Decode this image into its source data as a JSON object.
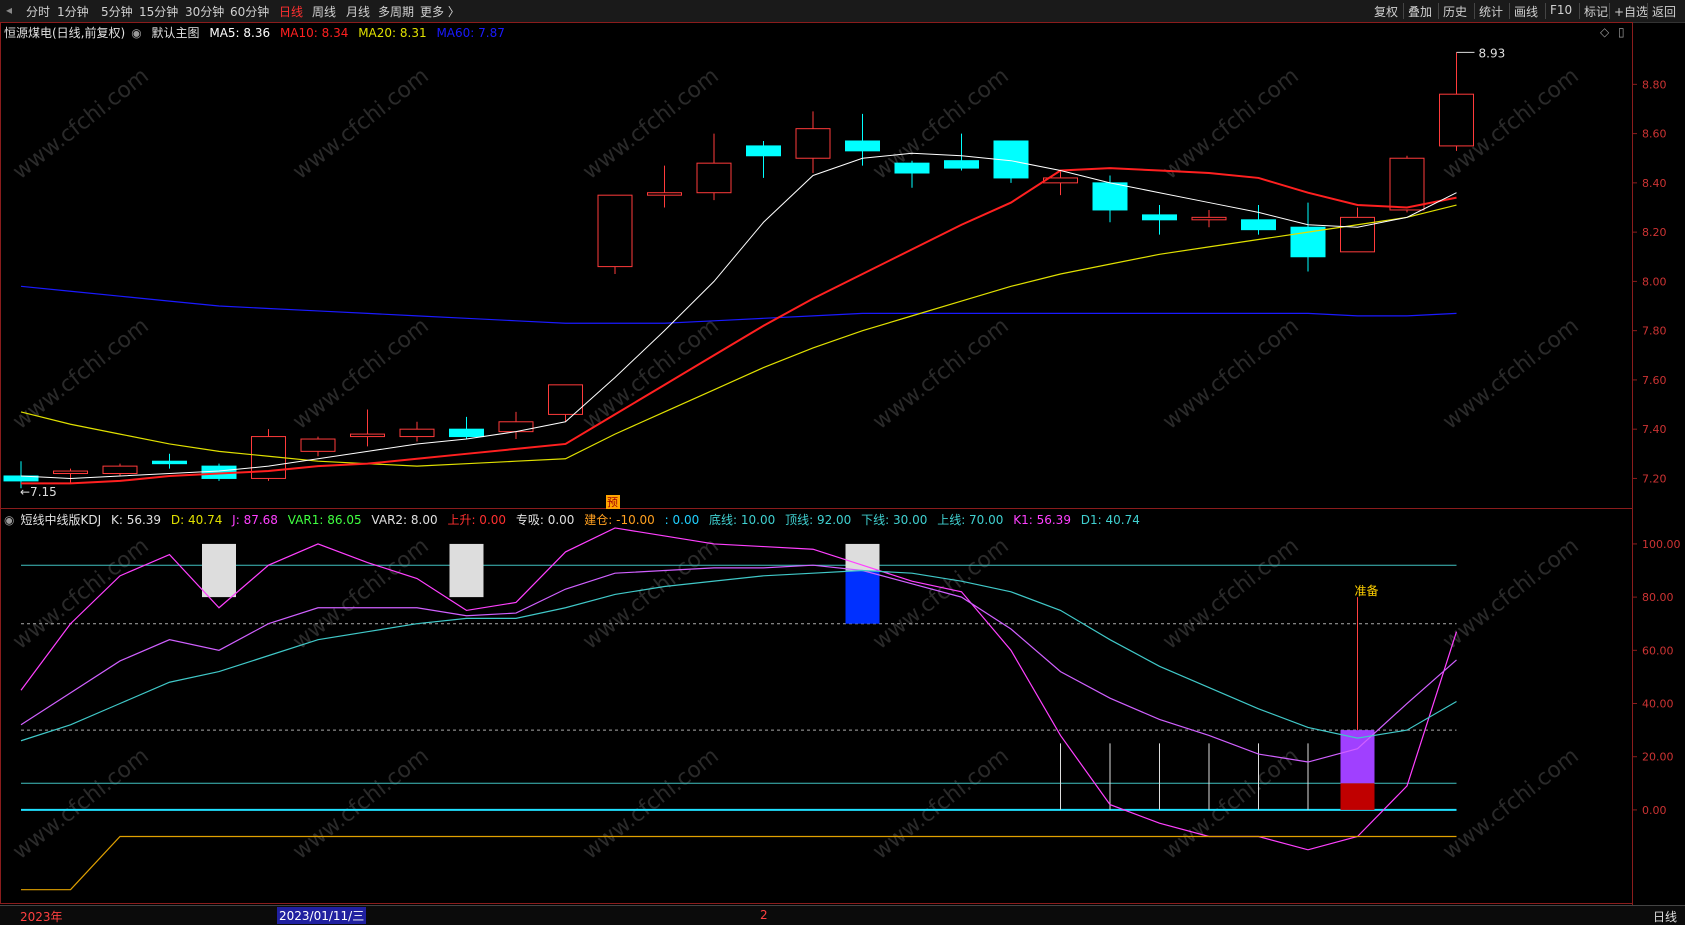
{
  "toolbar": {
    "left": [
      "分时",
      "1分钟",
      "5分钟",
      "15分钟",
      "30分钟",
      "60分钟",
      "日线",
      "周线",
      "月线",
      "多周期",
      "更多 〉"
    ],
    "active": "日线",
    "right": [
      "复权",
      "叠加",
      "历史",
      "统计",
      "画线",
      "F10",
      "标记",
      "+自选",
      "返回"
    ]
  },
  "main_legend": {
    "stock": "恒源煤电(日线,前复权)",
    "template": "默认主图",
    "ma5": "MA5: 8.36",
    "ma10": "MA10: 8.34",
    "ma20": "MA20: 8.31",
    "ma60": "MA60: 7.87"
  },
  "kdj_legend": {
    "name": "短线中线版KDJ",
    "k": "K: 56.39",
    "d": "D: 40.74",
    "j": "J: 87.68",
    "var1": "VAR1: 86.05",
    "var2": "VAR2: 8.00",
    "up": "上升: 0.00",
    "zx": "专吸: 0.00",
    "jc": "建仓: -10.00",
    "zero": ": 0.00",
    "bottom": "底线: 10.00",
    "top": "顶线: 92.00",
    "lower": "下线: 30.00",
    "upper": "上线: 70.00",
    "k1": "K1: 56.39",
    "d1": "D1: 40.74"
  },
  "annotations": {
    "high": "8.93",
    "low": "7.15",
    "pre": "预",
    "ready": "准备"
  },
  "bottom": {
    "year": "2023年",
    "date": "2023/01/11/三",
    "mark": "2",
    "daily_btn": "日线"
  },
  "watermark": "www.cfchi.com",
  "colors": {
    "up": "#ff3b3b",
    "down": "#00ffff",
    "ma5": "#ffffff",
    "ma10": "#ff2020",
    "ma20": "#e0e000",
    "ma60": "#1a1aff"
  },
  "chart_data": [
    {
      "type": "candlestick",
      "title": "恒源煤电(日线,前复权)",
      "y_ticks": [
        7.2,
        7.4,
        7.6,
        7.8,
        8.0,
        8.2,
        8.4,
        8.6,
        8.8
      ],
      "ylim": [
        7.08,
        8.98
      ],
      "candles": [
        {
          "o": 7.21,
          "c": 7.19,
          "h": 7.27,
          "l": 7.16
        },
        {
          "o": 7.22,
          "c": 7.23,
          "h": 7.24,
          "l": 7.18
        },
        {
          "o": 7.22,
          "c": 7.25,
          "h": 7.26,
          "l": 7.21
        },
        {
          "o": 7.27,
          "c": 7.26,
          "h": 7.3,
          "l": 7.24
        },
        {
          "o": 7.25,
          "c": 7.2,
          "h": 7.26,
          "l": 7.19
        },
        {
          "o": 7.2,
          "c": 7.37,
          "h": 7.4,
          "l": 7.19
        },
        {
          "o": 7.31,
          "c": 7.36,
          "h": 7.37,
          "l": 7.29
        },
        {
          "o": 7.37,
          "c": 7.38,
          "h": 7.48,
          "l": 7.33
        },
        {
          "o": 7.37,
          "c": 7.4,
          "h": 7.43,
          "l": 7.35
        },
        {
          "o": 7.4,
          "c": 7.37,
          "h": 7.45,
          "l": 7.36
        },
        {
          "o": 7.39,
          "c": 7.43,
          "h": 7.47,
          "l": 7.36
        },
        {
          "o": 7.46,
          "c": 7.58,
          "h": 7.58,
          "l": 7.43
        },
        {
          "o": 8.06,
          "c": 8.35,
          "h": 8.35,
          "l": 8.03
        },
        {
          "o": 8.35,
          "c": 8.36,
          "h": 8.47,
          "l": 8.3
        },
        {
          "o": 8.36,
          "c": 8.48,
          "h": 8.6,
          "l": 8.33
        },
        {
          "o": 8.55,
          "c": 8.51,
          "h": 8.57,
          "l": 8.42
        },
        {
          "o": 8.5,
          "c": 8.62,
          "h": 8.69,
          "l": 8.44
        },
        {
          "o": 8.57,
          "c": 8.53,
          "h": 8.68,
          "l": 8.47
        },
        {
          "o": 8.48,
          "c": 8.44,
          "h": 8.49,
          "l": 8.38
        },
        {
          "o": 8.49,
          "c": 8.46,
          "h": 8.6,
          "l": 8.45
        },
        {
          "o": 8.57,
          "c": 8.42,
          "h": 8.57,
          "l": 8.4
        },
        {
          "o": 8.4,
          "c": 8.42,
          "h": 8.45,
          "l": 8.35
        },
        {
          "o": 8.4,
          "c": 8.29,
          "h": 8.43,
          "l": 8.24
        },
        {
          "o": 8.27,
          "c": 8.25,
          "h": 8.31,
          "l": 8.19
        },
        {
          "o": 8.25,
          "c": 8.26,
          "h": 8.29,
          "l": 8.22
        },
        {
          "o": 8.25,
          "c": 8.21,
          "h": 8.31,
          "l": 8.19
        },
        {
          "o": 8.22,
          "c": 8.1,
          "h": 8.32,
          "l": 8.04
        },
        {
          "o": 8.12,
          "c": 8.26,
          "h": 8.3,
          "l": 8.12
        },
        {
          "o": 8.29,
          "c": 8.5,
          "h": 8.51,
          "l": 8.28
        },
        {
          "o": 8.55,
          "c": 8.76,
          "h": 8.93,
          "l": 8.53
        }
      ],
      "ma5": [
        7.21,
        7.2,
        7.21,
        7.22,
        7.23,
        7.25,
        7.28,
        7.31,
        7.34,
        7.36,
        7.39,
        7.43,
        7.61,
        7.8,
        8.0,
        8.24,
        8.43,
        8.5,
        8.52,
        8.51,
        8.49,
        8.45,
        8.4,
        8.36,
        8.32,
        8.28,
        8.23,
        8.22,
        8.26,
        8.36
      ],
      "ma10": [
        7.18,
        7.18,
        7.19,
        7.21,
        7.22,
        7.23,
        7.25,
        7.26,
        7.28,
        7.3,
        7.32,
        7.34,
        7.46,
        7.58,
        7.7,
        7.82,
        7.93,
        8.03,
        8.13,
        8.23,
        8.32,
        8.45,
        8.46,
        8.45,
        8.44,
        8.42,
        8.36,
        8.31,
        8.3,
        8.34
      ],
      "ma20": [
        7.47,
        7.42,
        7.38,
        7.34,
        7.31,
        7.29,
        7.27,
        7.26,
        7.25,
        7.26,
        7.27,
        7.28,
        7.38,
        7.47,
        7.56,
        7.65,
        7.73,
        7.8,
        7.86,
        7.92,
        7.98,
        8.03,
        8.07,
        8.11,
        8.14,
        8.17,
        8.2,
        8.23,
        8.26,
        8.31
      ],
      "ma60": [
        7.98,
        7.96,
        7.94,
        7.92,
        7.9,
        7.89,
        7.88,
        7.87,
        7.86,
        7.85,
        7.84,
        7.83,
        7.83,
        7.83,
        7.84,
        7.85,
        7.86,
        7.87,
        7.87,
        7.87,
        7.87,
        7.87,
        7.87,
        7.87,
        7.87,
        7.87,
        7.87,
        7.86,
        7.86,
        7.87
      ]
    },
    {
      "type": "line",
      "title": "短线中线版KDJ",
      "y_ticks": [
        0,
        20,
        40,
        60,
        80,
        100
      ],
      "ylim": [
        -35,
        112
      ],
      "reference_lines": {
        "bottom": 10,
        "top": 92,
        "lower": 30,
        "upper": 70,
        "zero": 0,
        "jc": -10
      },
      "series": [
        {
          "name": "J",
          "values": [
            45,
            70,
            88,
            96,
            76,
            92,
            100,
            93,
            87,
            75,
            78,
            97,
            106,
            103,
            100,
            99,
            98,
            92,
            86,
            82,
            60,
            28,
            2,
            -5,
            -10,
            -10,
            -15,
            -10,
            9,
            67,
            87.68
          ]
        },
        {
          "name": "K",
          "values": [
            32,
            44,
            56,
            64,
            60,
            70,
            76,
            76,
            76,
            73,
            74,
            83,
            89,
            90,
            91,
            91,
            92,
            90,
            85,
            80,
            68,
            52,
            42,
            34,
            28,
            21,
            18,
            23,
            40,
            56.39
          ]
        },
        {
          "name": "D",
          "values": [
            26,
            32,
            40,
            48,
            52,
            58,
            64,
            67,
            70,
            72,
            72,
            76,
            81,
            84,
            86,
            88,
            89,
            90,
            89,
            86,
            82,
            75,
            64,
            54,
            46,
            38,
            31,
            27,
            30,
            40.74
          ]
        },
        {
          "name": "建仓",
          "values": [
            -30,
            -30,
            -10,
            -10,
            -10,
            -10,
            -10,
            -10,
            -10,
            -10,
            -10,
            -10,
            -10,
            -10,
            -10,
            -10,
            -10,
            -10,
            -10,
            -10,
            -10,
            -10,
            -10,
            -10,
            -10,
            -10,
            -10,
            -10,
            -10,
            -10
          ]
        }
      ]
    }
  ]
}
